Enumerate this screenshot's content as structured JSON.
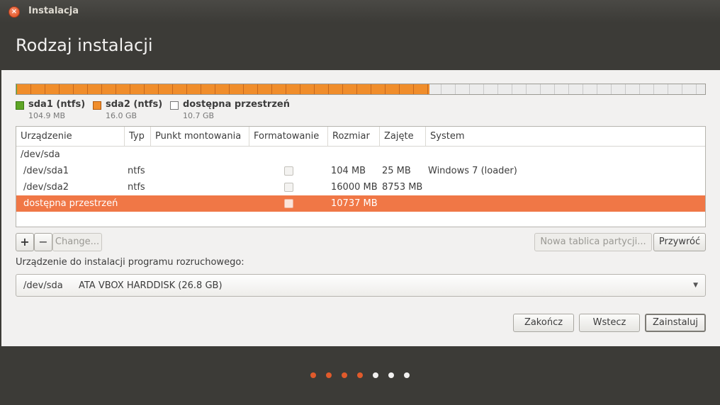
{
  "window": {
    "title": "Instalacja"
  },
  "page": {
    "title": "Rodzaj instalacji"
  },
  "partition_bar": {
    "segments": [
      {
        "name": "sda1 (ntfs)",
        "size": "104.9 MB",
        "fraction": 0.001,
        "color": "#5ea526"
      },
      {
        "name": "sda2 (ntfs)",
        "size": "16.0 GB",
        "fraction": 0.598,
        "color": "#f08d2b"
      },
      {
        "name": "dostępna przestrzeń",
        "size": "10.7 GB",
        "fraction": 0.401,
        "color": "#ffffff"
      }
    ]
  },
  "table": {
    "columns": [
      "Urządzenie",
      "Typ",
      "Punkt montowania",
      "Formatowanie",
      "Rozmiar",
      "Zajęte",
      "System"
    ],
    "rows": [
      {
        "device": "/dev/sda",
        "type": "",
        "mount": "",
        "format": null,
        "size": "",
        "used": "",
        "system": ""
      },
      {
        "device": "/dev/sda1",
        "type": "ntfs",
        "mount": "",
        "format": false,
        "size": "104 MB",
        "used": "25 MB",
        "system": "Windows 7 (loader)"
      },
      {
        "device": "/dev/sda2",
        "type": "ntfs",
        "mount": "",
        "format": false,
        "size": "16000 MB",
        "used": "8753 MB",
        "system": ""
      },
      {
        "device": "dostępna przestrzeń",
        "type": "",
        "mount": "",
        "format": false,
        "size": "10737 MB",
        "used": "",
        "system": "",
        "selected": true
      }
    ]
  },
  "toolbar": {
    "add": "+",
    "remove": "−",
    "change": "Change...",
    "new_table": "Nowa tablica partycji...",
    "revert": "Przywróć"
  },
  "boot": {
    "label": "Urządzenie do instalacji programu rozruchowego:",
    "device": "/dev/sda",
    "description": "ATA VBOX HARDDISK (26.8 GB)"
  },
  "actions": {
    "quit": "Zakończ",
    "back": "Wstecz",
    "install": "Zainstaluj"
  },
  "progress_dots": {
    "total": 7,
    "completed": 4,
    "active_color": "#e05a2b",
    "inactive_color": "#f2f1f0"
  },
  "icons": {
    "close": "close-icon",
    "combo_arrow": "chevron-down-icon"
  }
}
